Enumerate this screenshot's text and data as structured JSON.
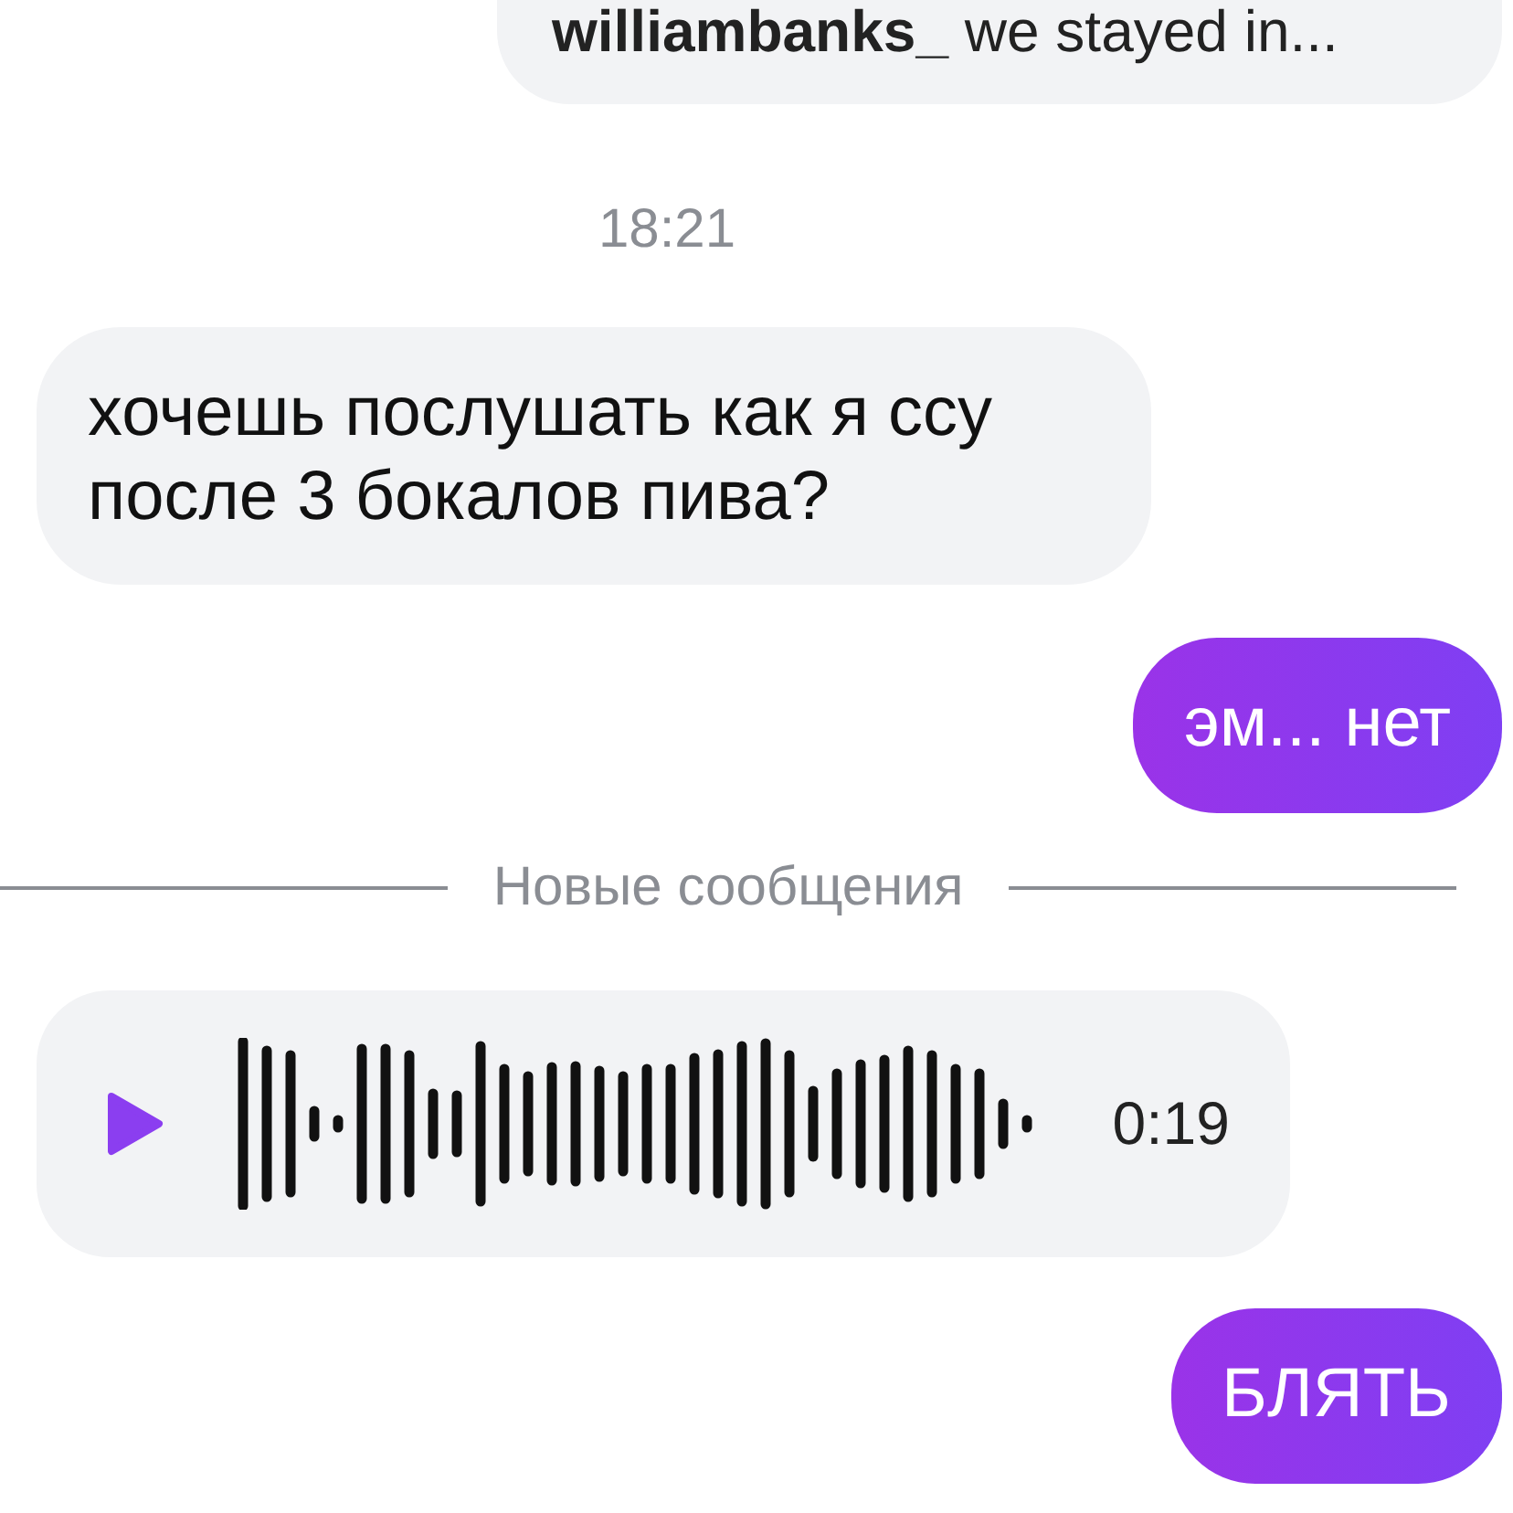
{
  "messages": [
    {
      "kind": "text",
      "outgoing": true,
      "text": "**williambanks_** we stayed in..."
    },
    {
      "kind": "time",
      "text": "18:21"
    },
    {
      "kind": "text",
      "outgoing": false,
      "text": "хочешь послушать как я ссу после 3 бокалов пива?"
    },
    {
      "kind": "text",
      "outgoing": true,
      "text": "эм... нет"
    },
    {
      "kind": "divider",
      "text": "Новые сообщения"
    },
    {
      "kind": "voice",
      "duration": "0:19"
    },
    {
      "kind": "text",
      "outgoing": true,
      "text": "БЛЯТЬ"
    }
  ]
}
